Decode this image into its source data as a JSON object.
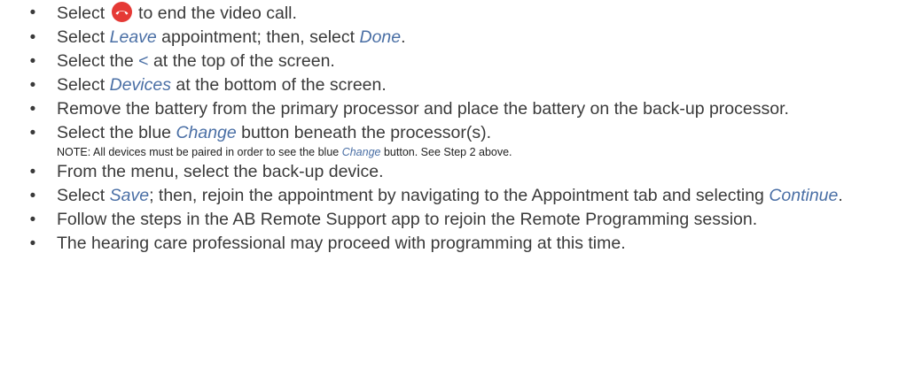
{
  "steps": [
    {
      "pre": "Select",
      "post": "to end the video call.",
      "icon": "end-call-icon",
      "icon_color": "#e53935"
    },
    {
      "t1": "Select ",
      "em1": "Leave",
      "t2": " appointment; then, select ",
      "em2": "Done",
      "t3": "."
    },
    {
      "t1": "Select the ",
      "em1": "<",
      "t2": " at the top of the screen."
    },
    {
      "t1": "Select ",
      "em1": "Devices",
      "t2": " at the bottom of the screen."
    },
    {
      "text": "Remove the battery from the primary processor and place the battery on the back-up processor."
    },
    {
      "t1": "Select the blue ",
      "em1": "Change",
      "t2": " button beneath the processor(s).",
      "note": {
        "t1": "NOTE: All devices must be paired in order to see the blue ",
        "em": "Change",
        "t2": " button. See Step 2 above."
      }
    },
    {
      "text": "From the menu, select the back-up device."
    },
    {
      "t1": "Select ",
      "em1": "Save",
      "t2": "; then, rejoin the appointment by navigating to the Appointment tab and selecting ",
      "em2": "Continue",
      "t3": "."
    },
    {
      "text": "Follow the steps in the AB Remote Support app to rejoin the Remote Programming session."
    },
    {
      "text": "The hearing care professional may proceed with programming at this time."
    }
  ],
  "bullet_char": "•",
  "colors": {
    "text": "#3a3a3a",
    "emphasis": "#4a6fa5",
    "end_call": "#e53935"
  }
}
